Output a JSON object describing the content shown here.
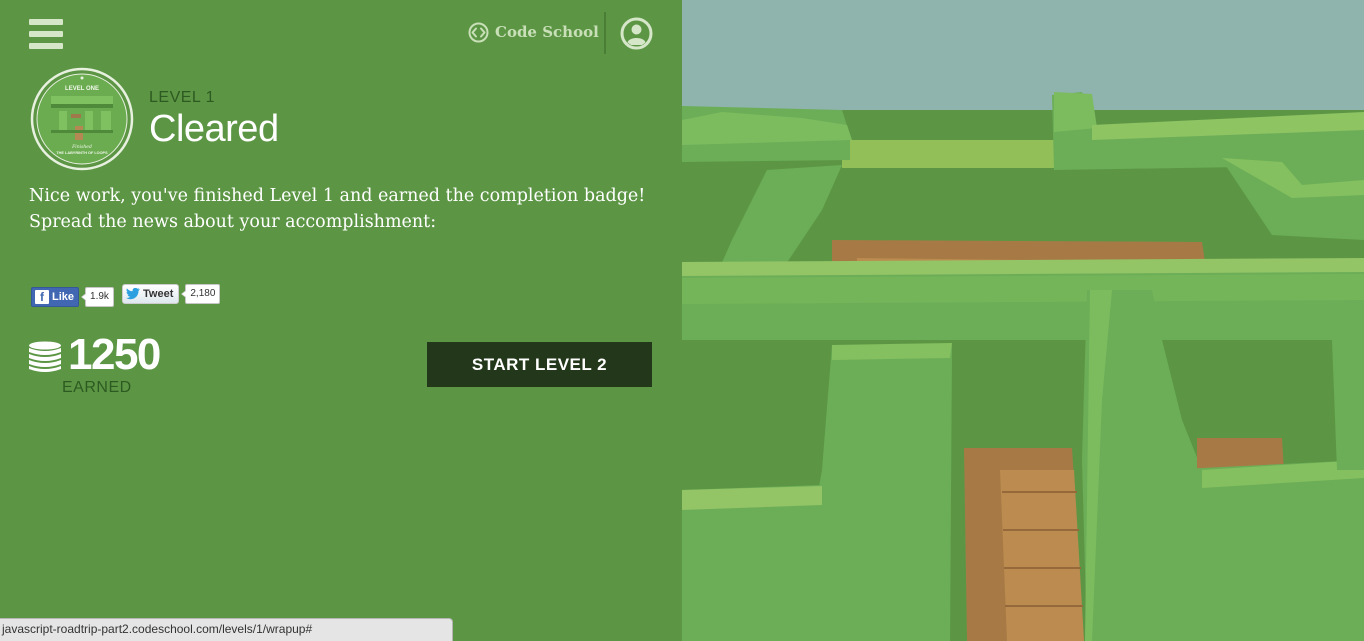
{
  "header": {
    "menu_icon": "hamburger-menu-icon",
    "brand_icon": "code-brackets-icon",
    "brand_name": "Code School",
    "user_icon": "user-avatar-icon"
  },
  "badge": {
    "title": "LEVEL ONE",
    "subtitle": "THE LABYRINTH OF LOOPS",
    "script_text": "Finished"
  },
  "level": {
    "label": "LEVEL 1",
    "status": "Cleared"
  },
  "message": {
    "line1": "Nice work, you've finished Level 1 and earned the completion badge!",
    "line2": "Spread the news about your accomplishment:"
  },
  "social": {
    "facebook": {
      "label": "Like",
      "count": "1.9k"
    },
    "twitter": {
      "label": "Tweet",
      "count": "2,180"
    }
  },
  "points": {
    "value": "1250",
    "label": "EARNED",
    "icon": "coin-stack-icon"
  },
  "cta": {
    "label": "START LEVEL 2"
  },
  "status_bar": {
    "url": "javascript-roadtrip-part2.codeschool.com/levels/1/wrapup#"
  },
  "colors": {
    "panel_green": "#5c9645",
    "button_dark": "#23381b",
    "label_dark_green": "#2d5a20",
    "sky": "#8fb3ad"
  }
}
